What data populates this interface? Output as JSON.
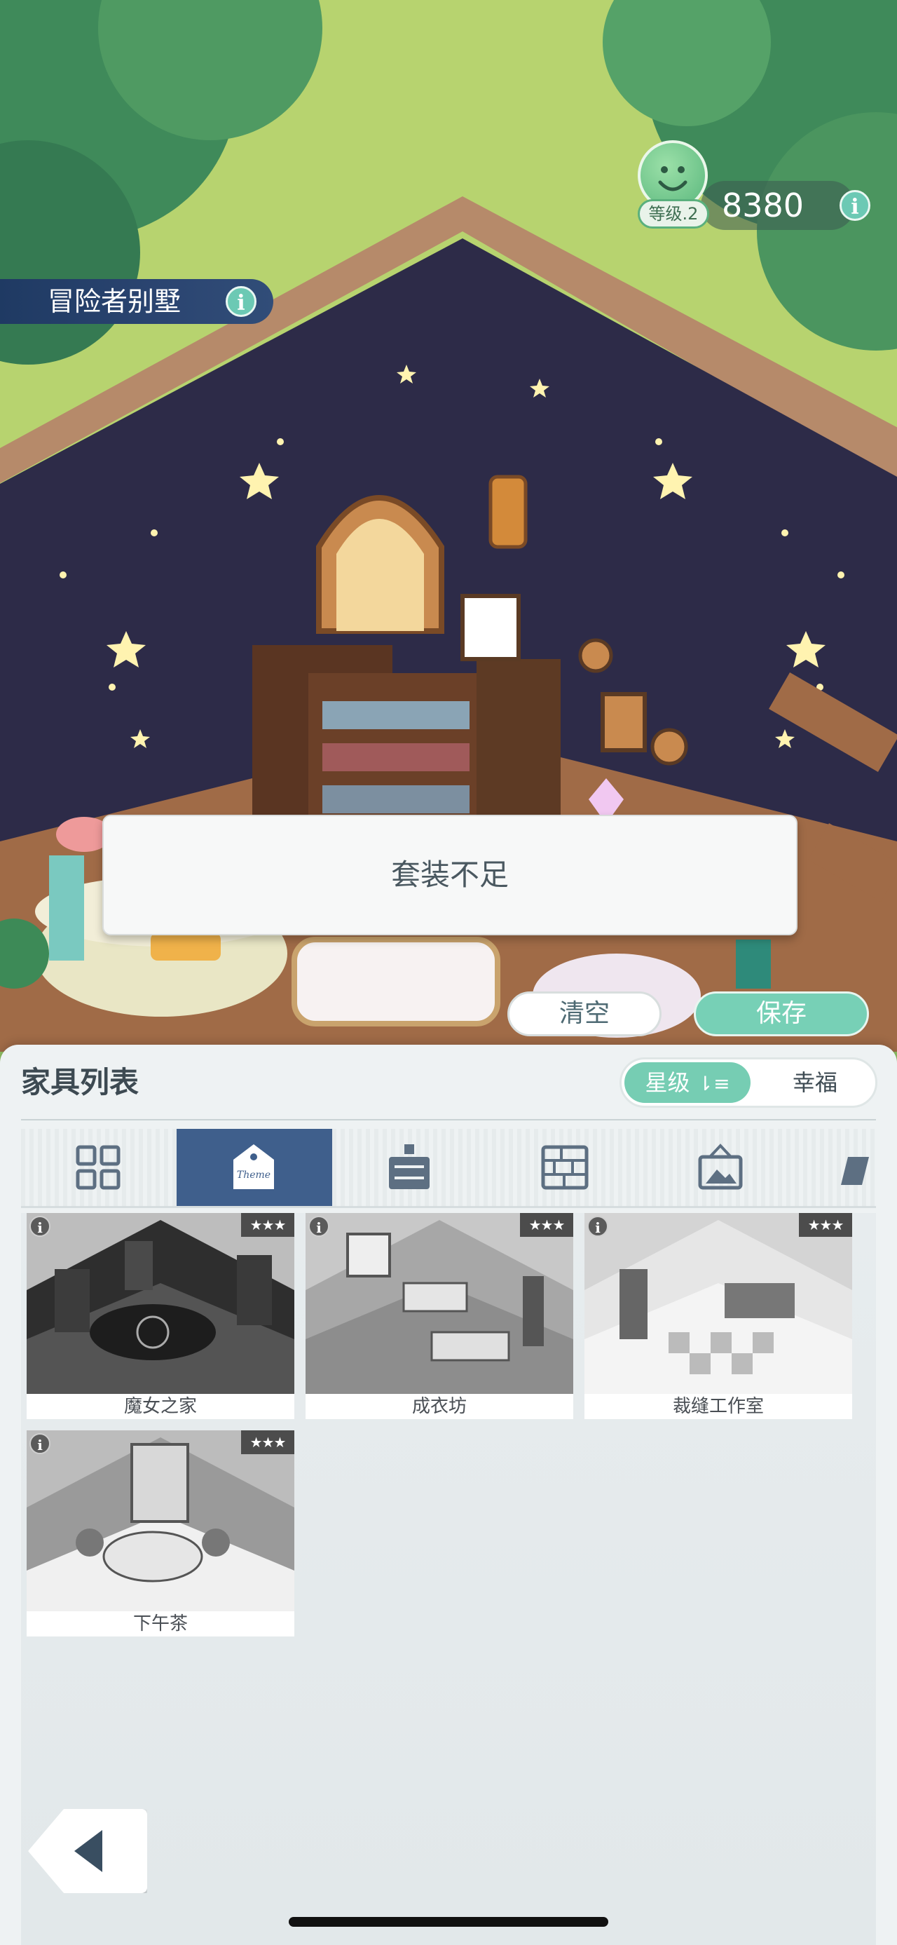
{
  "hud": {
    "level_label": "等级.2",
    "score": "8380",
    "room_name": "冒险者别墅",
    "info_glyph": "i"
  },
  "toast": {
    "message": "套装不足"
  },
  "actions": {
    "clear_label": "清空",
    "save_label": "保存"
  },
  "panel": {
    "title": "家具列表",
    "sort_star_label": "星级",
    "sort_happy_label": "幸福"
  },
  "tabs": [
    {
      "icon": "grid-icon",
      "active": false
    },
    {
      "icon": "theme-tag-icon",
      "active": true
    },
    {
      "icon": "cabinet-icon",
      "active": false
    },
    {
      "icon": "wall-icon",
      "active": false
    },
    {
      "icon": "picture-icon",
      "active": false
    },
    {
      "icon": "floor-icon",
      "active": false
    }
  ],
  "theme_sets": [
    {
      "name": "魔女之家",
      "stars": "★★★",
      "info": "i"
    },
    {
      "name": "成衣坊",
      "stars": "★★★",
      "info": "i"
    },
    {
      "name": "裁缝工作室",
      "stars": "★★★",
      "info": "i"
    },
    {
      "name": "下午茶",
      "stars": "★★★",
      "info": "i"
    }
  ],
  "colors": {
    "accent": "#76cdb3",
    "active_tab": "#3f5f8c",
    "room_wall": "#2d2b48"
  }
}
